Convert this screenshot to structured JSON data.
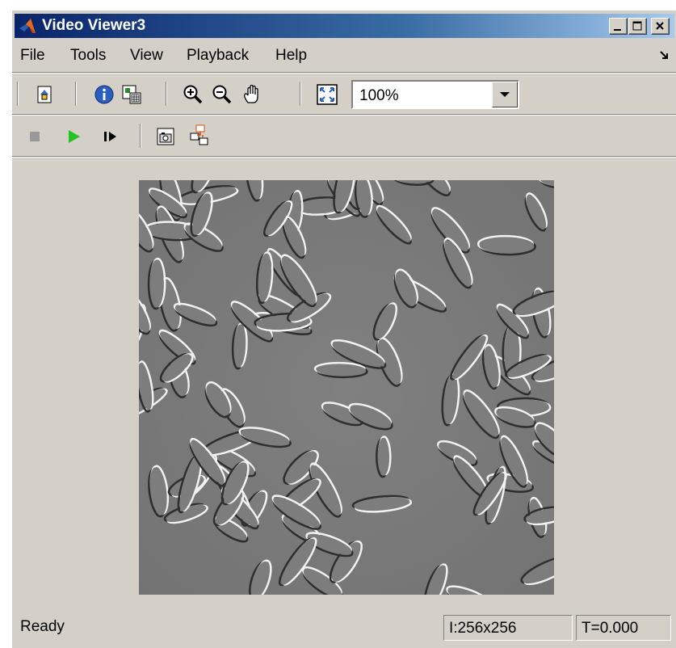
{
  "window": {
    "title": "Video Viewer3"
  },
  "menu": {
    "items": [
      "File",
      "Tools",
      "View",
      "Playback",
      "Help"
    ]
  },
  "toolbar": {
    "zoom_value": "100%"
  },
  "status": {
    "text": "Ready",
    "dimensions": "I:256x256",
    "time": "T=0.000"
  },
  "icons": {
    "app": "matlab-logo-icon",
    "minimize": "minimize-icon",
    "maximize": "maximize-icon",
    "close": "close-icon"
  }
}
